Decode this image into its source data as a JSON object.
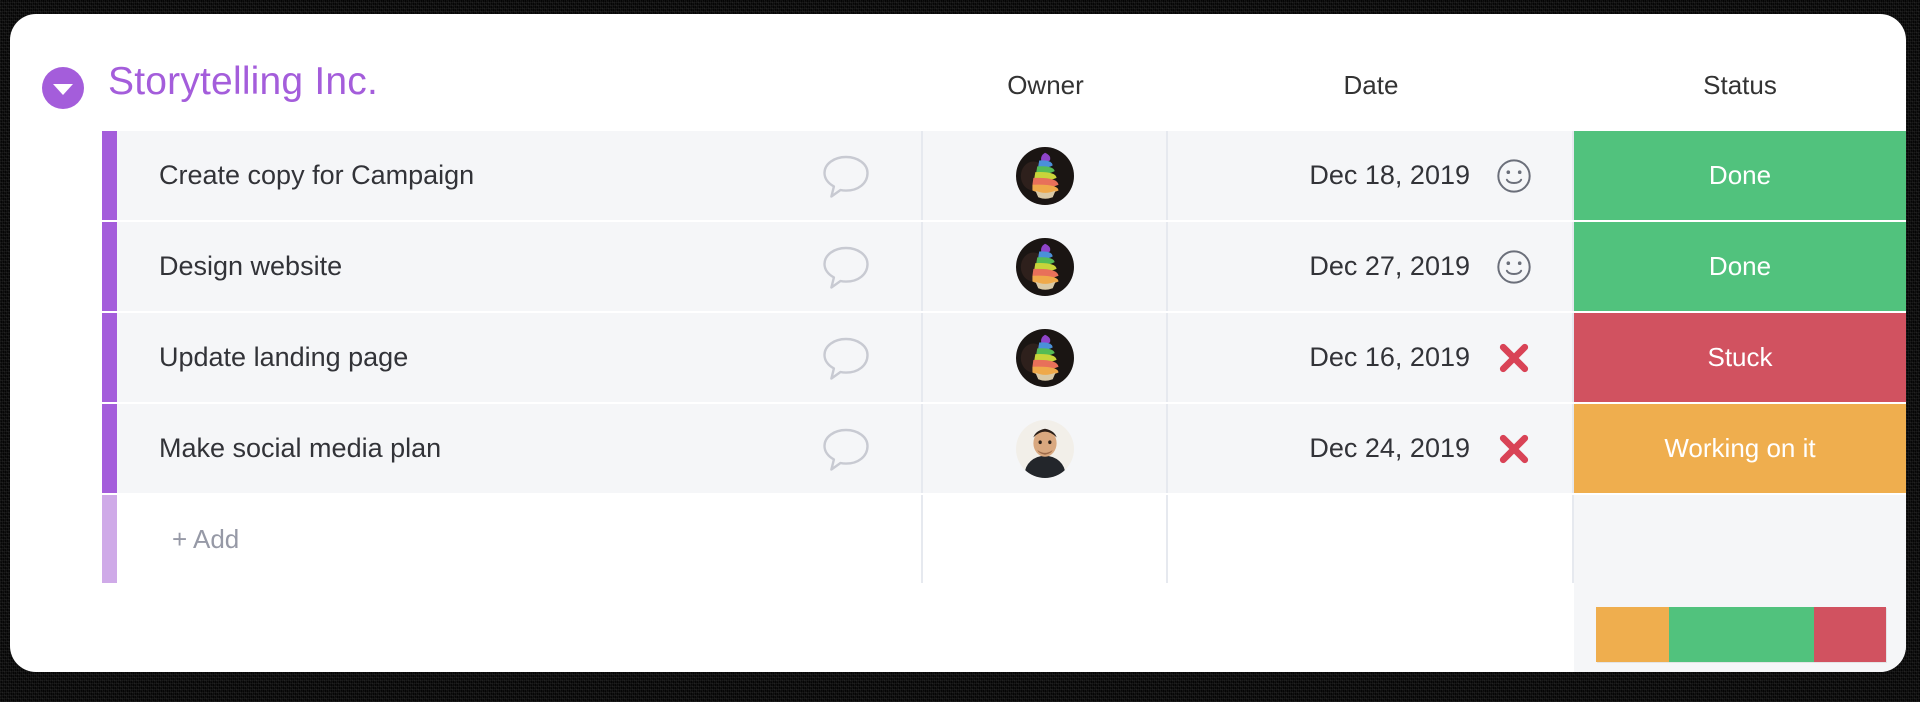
{
  "board": {
    "title": "Storytelling Inc.",
    "collapse_icon": "caret-down-icon",
    "accent_color": "#a45ddb"
  },
  "columns": {
    "name": "",
    "owner": "Owner",
    "date": "Date",
    "status": "Status"
  },
  "rows": [
    {
      "task": "Create copy for Campaign",
      "update_icon": "speech-bubble-icon",
      "owner_avatar": "rainbow-ice-cream-avatar",
      "date": "Dec 18, 2019",
      "date_icon": "smiley-face-icon",
      "status": "Done",
      "status_color": "#51c27d",
      "color_bar": "#a45ddb"
    },
    {
      "task": "Design website",
      "update_icon": "speech-bubble-icon",
      "owner_avatar": "rainbow-ice-cream-avatar",
      "date": "Dec 27, 2019",
      "date_icon": "smiley-face-icon",
      "status": "Done",
      "status_color": "#51c27d",
      "color_bar": "#a45ddb"
    },
    {
      "task": "Update landing page",
      "update_icon": "speech-bubble-icon",
      "owner_avatar": "rainbow-ice-cream-avatar",
      "date": "Dec 16, 2019",
      "date_icon": "red-x-icon",
      "status": "Stuck",
      "status_color": "#d15260",
      "color_bar": "#a45ddb"
    },
    {
      "task": "Make social media plan",
      "update_icon": "speech-bubble-icon",
      "owner_avatar": "person-photo-avatar",
      "date": "Dec 24, 2019",
      "date_icon": "red-x-icon",
      "status": "Working on it",
      "status_color": "#efae4e",
      "color_bar": "#a45ddb"
    }
  ],
  "add_row": {
    "label": "+ Add",
    "color_bar": "#cfaae8"
  },
  "summary": {
    "segments": [
      {
        "label": "Working on it",
        "color": "#efae4e",
        "percent": 25
      },
      {
        "label": "Done",
        "color": "#51c27d",
        "percent": 50
      },
      {
        "label": "Stuck",
        "color": "#d15260",
        "percent": 25
      }
    ]
  }
}
